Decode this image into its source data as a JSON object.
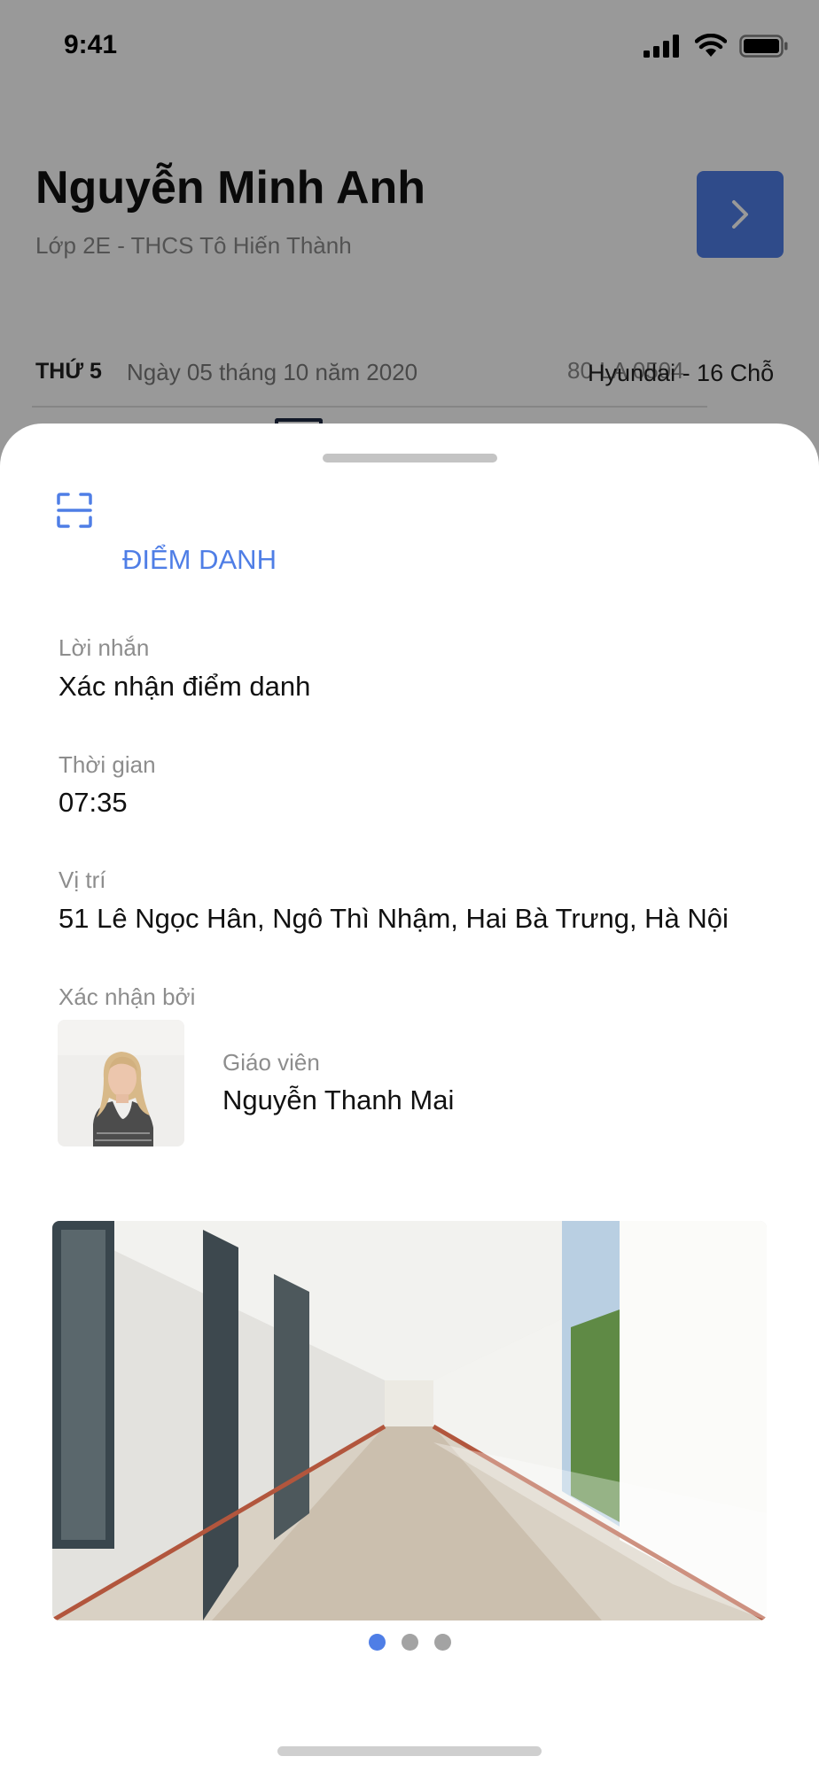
{
  "status_bar": {
    "time": "9:41"
  },
  "student": {
    "name": "Nguyễn Minh Anh",
    "class": "Lớp 2E - THCS Tô Hiến Thành"
  },
  "trip": {
    "day": "THỨ 5",
    "date": "Ngày 05 tháng 10 năm 2020",
    "plate": "80 LA 0504",
    "vehicle": "Hyundai - 16 Chỗ"
  },
  "sheet": {
    "title": "ĐIỂM DANH",
    "message_label": "Lời nhắn",
    "message_value": "Xác nhận điểm danh",
    "time_label": "Thời gian",
    "time_value": "07:35",
    "location_label": "Vị trí",
    "location_value": "51 Lê Ngọc Hân, Ngô Thì Nhậm, Hai Bà Trưng, Hà Nội",
    "confirmed_by_label": "Xác nhận bởi",
    "teacher": {
      "role": "Giáo viên",
      "name": "Nguyễn Thanh Mai"
    },
    "carousel": {
      "total": 3,
      "active_index": 0
    }
  },
  "colors": {
    "accent": "#4f7ee6",
    "muted_text": "#8d8d8d",
    "overlay": "rgba(0,0,0,0.40)"
  }
}
